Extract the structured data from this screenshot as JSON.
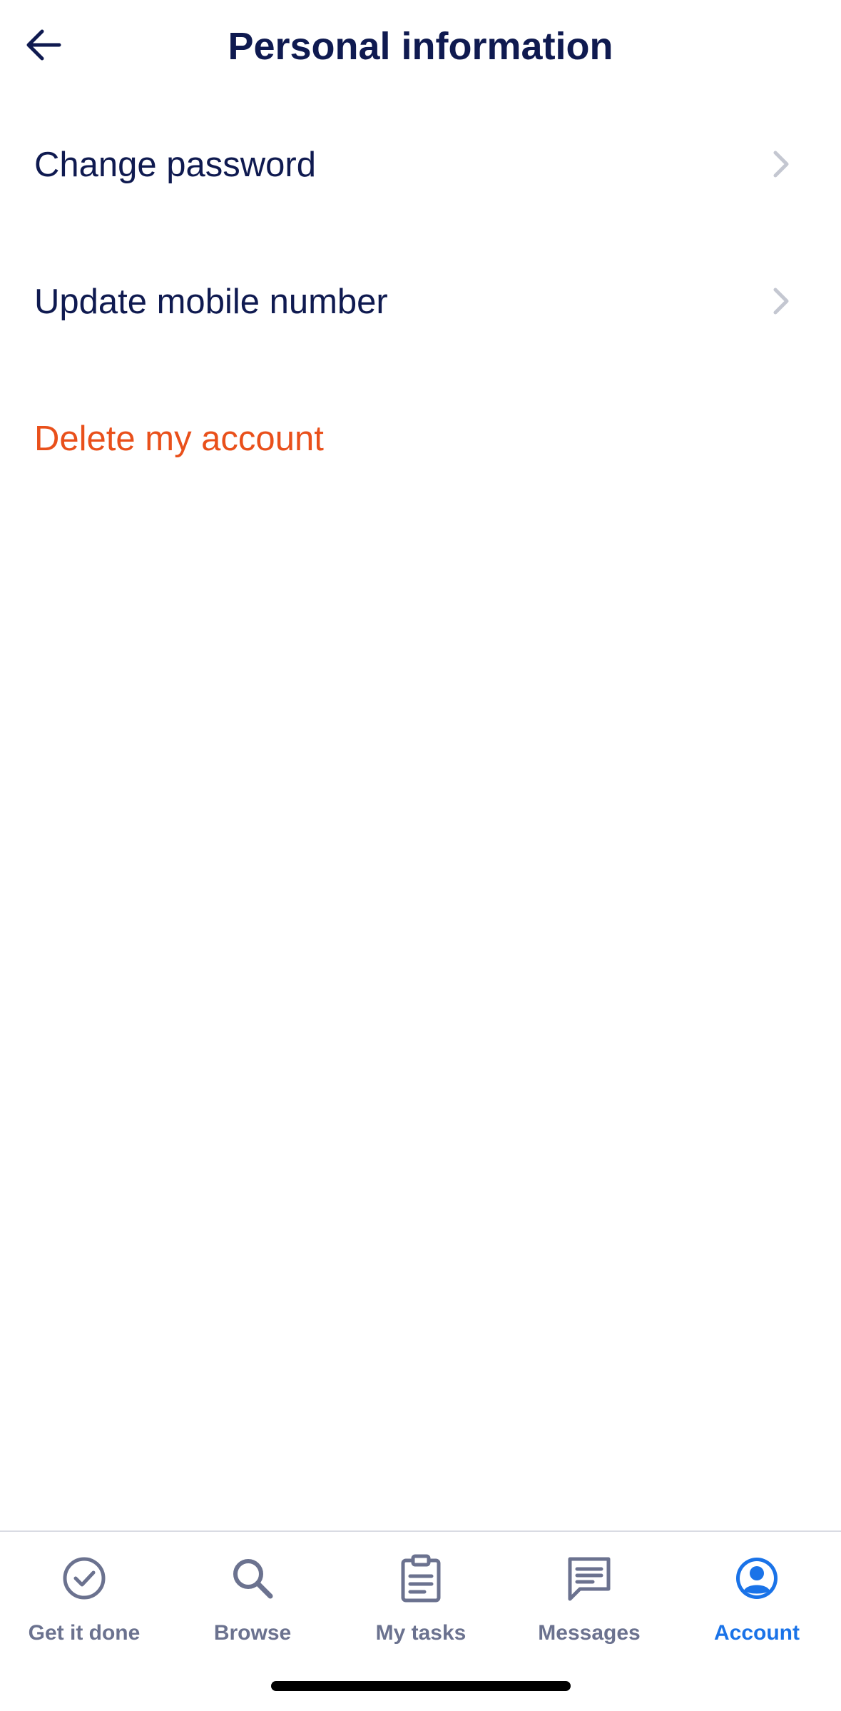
{
  "header": {
    "title": "Personal information",
    "back_icon": "arrow-left-icon"
  },
  "menu": [
    {
      "label": "Change password",
      "chevron": true
    },
    {
      "label": "Update mobile number",
      "chevron": true
    },
    {
      "label": "Delete my account",
      "chevron": false,
      "danger": true
    }
  ],
  "colors": {
    "primary_text": "#0f1a50",
    "danger": "#e9501b",
    "accent": "#1a73e8",
    "tab_inactive": "#6b728f",
    "chevron": "#c4c7d1"
  },
  "tabbar": {
    "items": [
      {
        "label": "Get it done",
        "icon": "check-circle-icon",
        "active": false
      },
      {
        "label": "Browse",
        "icon": "search-icon",
        "active": false
      },
      {
        "label": "My tasks",
        "icon": "clipboard-icon",
        "active": false
      },
      {
        "label": "Messages",
        "icon": "chat-icon",
        "active": false
      },
      {
        "label": "Account",
        "icon": "account-icon",
        "active": true
      }
    ]
  }
}
